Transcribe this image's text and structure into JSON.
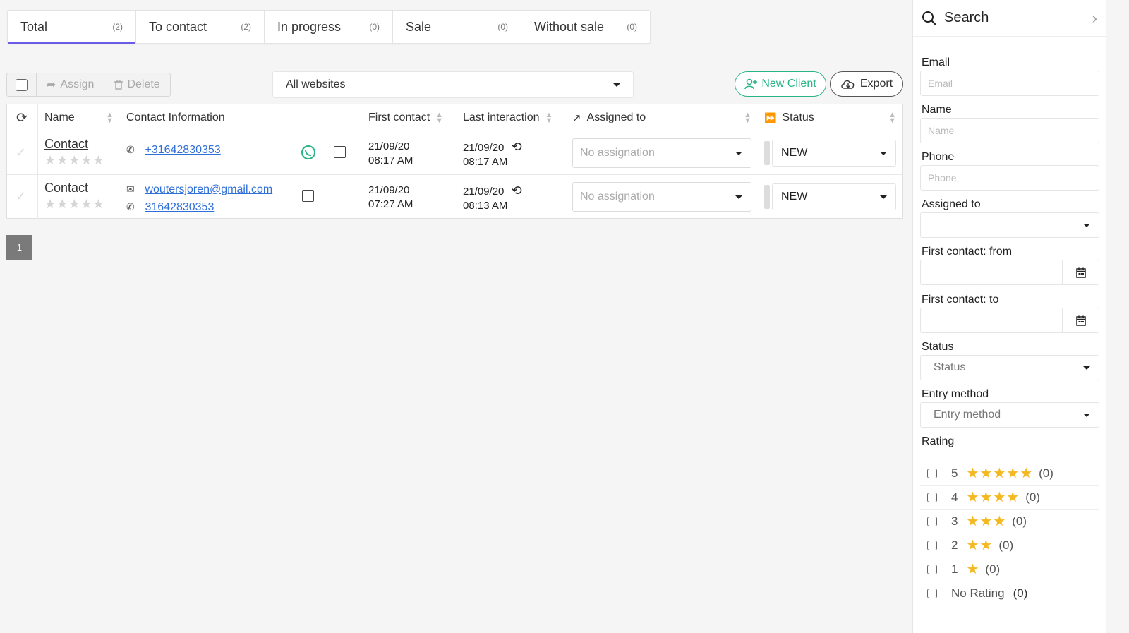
{
  "tabs": [
    {
      "label": "Total",
      "count": "(2)"
    },
    {
      "label": "To contact",
      "count": "(2)"
    },
    {
      "label": "In progress",
      "count": "(0)"
    },
    {
      "label": "Sale",
      "count": "(0)"
    },
    {
      "label": "Without sale",
      "count": "(0)"
    }
  ],
  "toolbar": {
    "assign_label": "Assign",
    "delete_label": "Delete",
    "website_select": "All websites",
    "new_client_label": "New Client",
    "export_label": "Export"
  },
  "table": {
    "headers": {
      "name": "Name",
      "contact_info": "Contact Information",
      "first_contact": "First contact",
      "last_interaction": "Last interaction",
      "assigned_to": "Assigned to",
      "status": "Status"
    },
    "rows": [
      {
        "name": "Contact",
        "phone": "+31642830353",
        "email": "",
        "first_contact_date": "21/09/20",
        "first_contact_time": "08:17 AM",
        "last_interaction_date": "21/09/20",
        "last_interaction_time": "08:17 AM",
        "assigned": "No assignation",
        "status": "NEW"
      },
      {
        "name": "Contact",
        "phone": "31642830353",
        "email": "woutersjoren@gmail.com",
        "first_contact_date": "21/09/20",
        "first_contact_time": "07:27 AM",
        "last_interaction_date": "21/09/20",
        "last_interaction_time": "08:13 AM",
        "assigned": "No assignation",
        "status": "NEW"
      }
    ]
  },
  "pagination": {
    "current": "1"
  },
  "search_panel": {
    "title": "Search",
    "email_label": "Email",
    "email_placeholder": "Email",
    "name_label": "Name",
    "name_placeholder": "Name",
    "phone_label": "Phone",
    "phone_placeholder": "Phone",
    "assigned_label": "Assigned to",
    "assigned_value": "",
    "first_from_label": "First contact: from",
    "first_to_label": "First contact: to",
    "status_label": "Status",
    "status_placeholder": "Status",
    "entry_label": "Entry method",
    "entry_placeholder": "Entry method",
    "rating_label": "Rating",
    "ratings": [
      {
        "value": "5",
        "stars": "★★★★★",
        "count": "(0)"
      },
      {
        "value": "4",
        "stars": "★★★★",
        "count": "(0)"
      },
      {
        "value": "3",
        "stars": "★★★",
        "count": "(0)"
      },
      {
        "value": "2",
        "stars": "★★",
        "count": "(0)"
      },
      {
        "value": "1",
        "stars": "★",
        "count": "(0)"
      }
    ],
    "no_rating_label": "No Rating",
    "no_rating_count": "(0)"
  },
  "colors": {
    "accent": "#6b5ce7",
    "green": "#29b585",
    "link": "#2f6fd8",
    "star": "#f4b820"
  }
}
